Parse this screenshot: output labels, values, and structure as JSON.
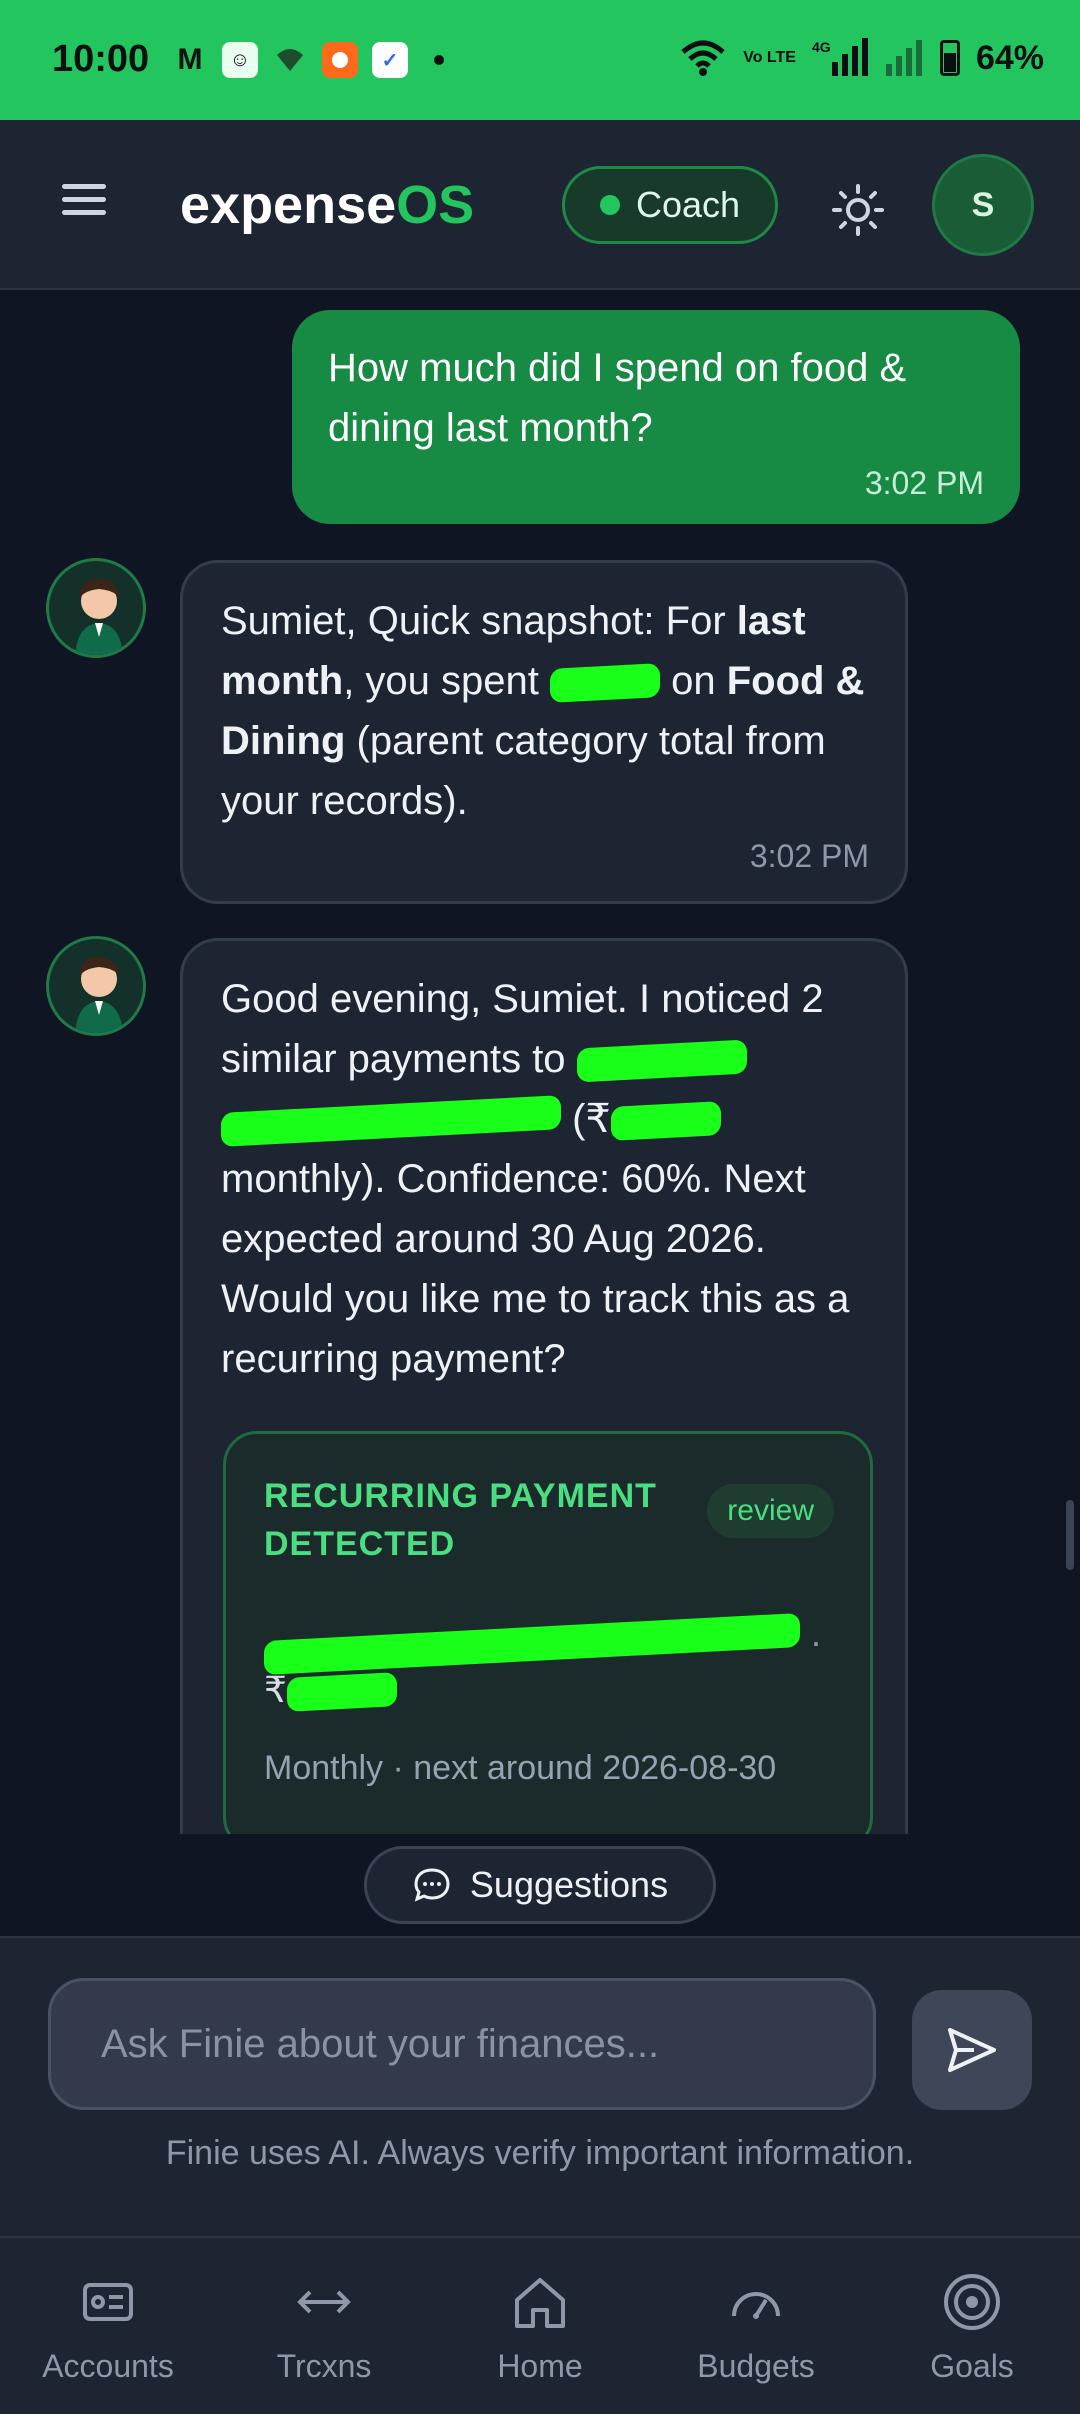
{
  "status_bar": {
    "time": "10:00",
    "network": "4G",
    "volte": "Vo LTE",
    "battery": "64%"
  },
  "header": {
    "logo_prefix": "expense",
    "logo_accent": "OS",
    "mode_label": "Coach",
    "avatar_initial": "S"
  },
  "chat": {
    "messages": [
      {
        "role": "user",
        "text": "How much did I spend on food & dining last month?",
        "time": "3:02 PM"
      },
      {
        "role": "bot",
        "text_1": "Sumiet, Quick snapshot: For ",
        "bold_1": "last month",
        "text_2": ", you spent ",
        "text_3": " on ",
        "bold_2": "Food & Dining",
        "text_4": " (parent category total from your records).",
        "time": "3:02 PM"
      },
      {
        "role": "bot",
        "text_1": "Good evening, Sumiet. I noticed 2 similar payments to ",
        "text_2": " (₹",
        "text_3": " monthly). Confidence: 60%. Next expected around 30 Aug 2026. Would you like me to track this as a recurring payment?",
        "card": {
          "title": "RECURRING PAYMENT DETECTED",
          "badge": "review",
          "currency": "₹",
          "frequency": "Monthly · next around 2026-08-30"
        }
      }
    ]
  },
  "suggestions_label": "Suggestions",
  "input": {
    "placeholder": "Ask Finie about your finances..."
  },
  "disclaimer": "Finie uses AI. Always verify important information.",
  "bottom_nav": [
    {
      "label": "Accounts",
      "icon": "accounts-icon"
    },
    {
      "label": "Trcxns",
      "icon": "transactions-icon"
    },
    {
      "label": "Home",
      "icon": "home-icon"
    },
    {
      "label": "Budgets",
      "icon": "budgets-icon"
    },
    {
      "label": "Goals",
      "icon": "goals-icon"
    }
  ],
  "colors": {
    "accent": "#22c55e",
    "user_bubble": "#178a44",
    "background": "#0f1522"
  }
}
